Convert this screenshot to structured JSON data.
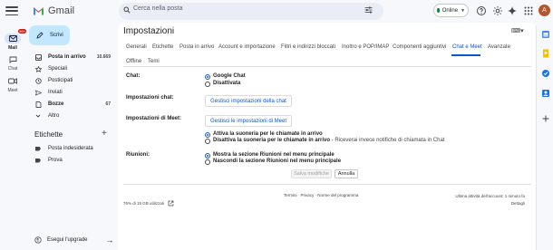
{
  "header": {
    "app_name": "Gmail",
    "search_placeholder": "Cerca nella posta",
    "status_label": "Online",
    "avatar_letter": "A"
  },
  "rail": {
    "mail_label": "Mail",
    "mail_badge": "99+",
    "chat_label": "Chat",
    "meet_label": "Meet"
  },
  "nav": {
    "compose_label": "Scrivi",
    "items": [
      {
        "label": "Posta in arrivo",
        "count": "10.669"
      },
      {
        "label": "Speciali",
        "count": ""
      },
      {
        "label": "Posticipati",
        "count": ""
      },
      {
        "label": "Inviati",
        "count": ""
      },
      {
        "label": "Bozze",
        "count": "67"
      },
      {
        "label": "Altro",
        "count": ""
      }
    ],
    "labels_title": "Etichette",
    "labels": [
      {
        "label": "Posta indesiderata"
      },
      {
        "label": "Prova"
      }
    ],
    "upgrade_label": "Esegui l'upgrade"
  },
  "settings": {
    "title": "Impostazioni",
    "tabs": [
      {
        "label": "Generali"
      },
      {
        "label": "Etichette"
      },
      {
        "label": "Posta in arrivo"
      },
      {
        "label": "Account e importazione"
      },
      {
        "label": "Filtri e indirizzi bloccati"
      },
      {
        "label": "Inoltro e POP/IMAP"
      },
      {
        "label": "Componenti aggiuntivi"
      },
      {
        "label": "Chat e Meet"
      },
      {
        "label": "Avanzate"
      },
      {
        "label": "Offline"
      },
      {
        "label": "Temi"
      }
    ],
    "active_tab": "Chat e Meet",
    "chat": {
      "label": "Chat:",
      "options": [
        "Google Chat",
        "Disattivata"
      ],
      "selected": "Google Chat"
    },
    "chat_settings": {
      "label": "Impostazioni chat:",
      "button": "Gestisci impostazioni della chat"
    },
    "meet_settings": {
      "label": "Impostazioni di Meet:",
      "button": "Gestisci le impostazioni di Meet",
      "ring_on": "Attiva la suoneria per le chiamate in arrivo",
      "ring_off": "Disattiva la suoneria per le chiamate in arrivo",
      "ring_off_note": " - Riceverai invece notifiche di chiamata in Chat",
      "selected": "Attiva la suoneria per le chiamate in arrivo"
    },
    "meetings": {
      "label": "Riunioni:",
      "show": "Mostra la sezione Riunioni nel menu principale",
      "hide": "Nascondi la sezione Riunioni nel menu principale",
      "selected": "Mostra la sezione Riunioni nel menu principale"
    },
    "save_label": "Salva modifiche",
    "cancel_label": "Annulla"
  },
  "footer": {
    "terms": "Termini",
    "privacy": "Privacy",
    "policy": "Norme del programma",
    "sep": " · ",
    "storage": "76% di 15 GB utilizzati",
    "activity_line1": "Ultima attività dell'account: 1 minuto fa",
    "activity_line2": "Dettagli"
  },
  "colors": {
    "accent": "#0b57d0",
    "compose_bg": "#c2e7ff",
    "status_green": "#188038",
    "badge_red": "#c5221f"
  }
}
